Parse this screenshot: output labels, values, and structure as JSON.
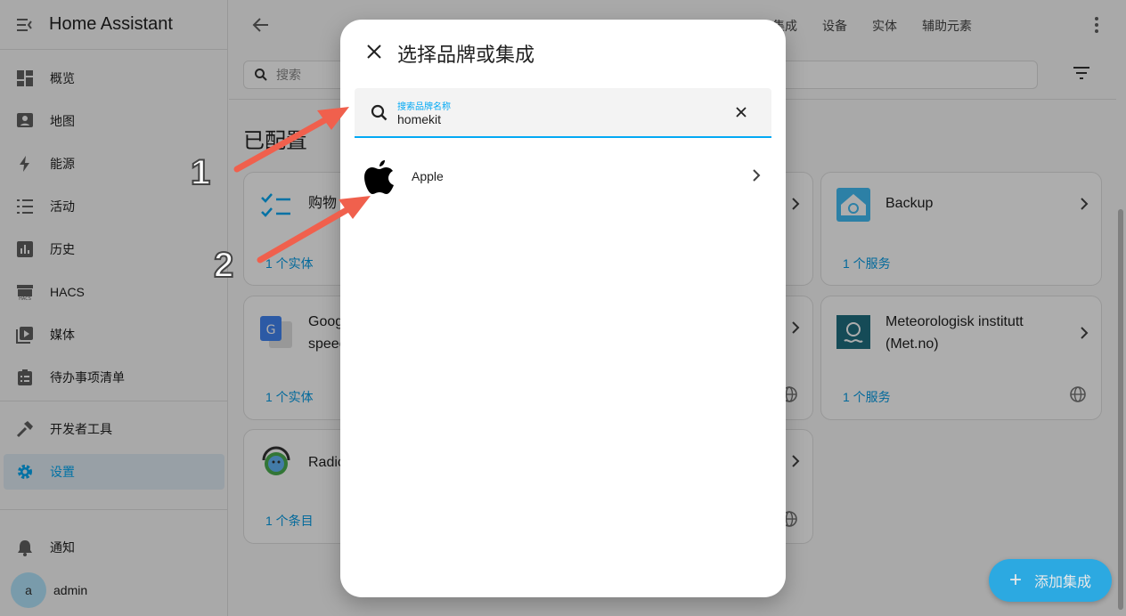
{
  "app": {
    "title": "Home Assistant"
  },
  "sidebar": {
    "items": [
      {
        "label": "概览",
        "icon": "dashboard-icon"
      },
      {
        "label": "地图",
        "icon": "map-icon"
      },
      {
        "label": "能源",
        "icon": "lightning-icon"
      },
      {
        "label": "活动",
        "icon": "list-icon"
      },
      {
        "label": "历史",
        "icon": "chart-icon"
      },
      {
        "label": "HACS",
        "icon": "hacs-icon"
      },
      {
        "label": "媒体",
        "icon": "media-icon"
      },
      {
        "label": "待办事项清单",
        "icon": "clipboard-icon"
      },
      {
        "label": "开发者工具",
        "icon": "hammer-icon"
      },
      {
        "label": "设置",
        "icon": "gear-icon",
        "active": true
      }
    ],
    "notifications": "通知",
    "user": {
      "initial": "a",
      "name": "admin"
    }
  },
  "main": {
    "tabs_text": "集成　　设备　　实体　　辅助元素",
    "search_placeholder": "搜索",
    "section_title": "已配置",
    "cards": [
      {
        "title": "购物",
        "footer": "1 个实体"
      },
      {
        "title": "Backup",
        "footer": "1 个服务"
      },
      {
        "title": "Goog",
        "title2": "speec",
        "footer": "1 个实体"
      },
      {
        "title": "Meteorologisk institutt",
        "title2": "(Met.no)",
        "footer": "1 个服务"
      },
      {
        "title": "Radic",
        "footer": "1 个条目"
      }
    ],
    "fab_label": "添加集成"
  },
  "dialog": {
    "title": "选择品牌或集成",
    "search_label": "搜索品牌名称",
    "search_value": "homekit",
    "results": [
      {
        "label": "Apple",
        "icon": "apple-icon"
      }
    ]
  },
  "annotations": {
    "step1": "1",
    "step2": "2"
  },
  "colors": {
    "accent": "#03a9f4",
    "arrow": "#f0604d"
  }
}
